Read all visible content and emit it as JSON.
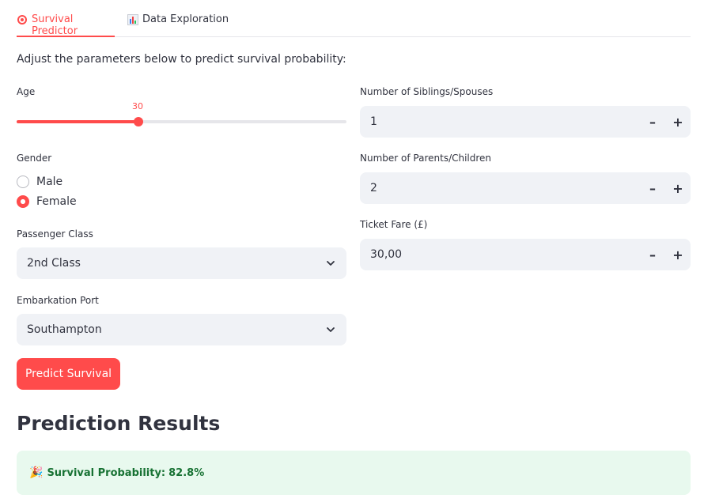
{
  "tabs": [
    {
      "label": "Survival Predictor",
      "icon": "target-icon",
      "active": true
    },
    {
      "label": "Data Exploration",
      "icon": "bar-chart-icon",
      "active": false
    }
  ],
  "instructions": "Adjust the parameters below to predict survival probability:",
  "age": {
    "label": "Age",
    "value": "30",
    "fraction": 0.36
  },
  "gender": {
    "label": "Gender",
    "options": [
      "Male",
      "Female"
    ],
    "selected": "Female"
  },
  "passenger_class": {
    "label": "Passenger Class",
    "value": "2nd Class"
  },
  "embarkation": {
    "label": "Embarkation Port",
    "value": "Southampton"
  },
  "siblings": {
    "label": "Number of Siblings/Spouses",
    "value": "1"
  },
  "parents": {
    "label": "Number of Parents/Children",
    "value": "2"
  },
  "fare": {
    "label": "Ticket Fare (£)",
    "value": "30,00"
  },
  "stepper": {
    "minus": "–",
    "plus": "+"
  },
  "predict_button": "Predict Survival",
  "results": {
    "heading": "Prediction Results",
    "emoji": "🎉",
    "label": "Survival Probability:",
    "value": "82.8%"
  },
  "colors": {
    "accent": "#ff4b4b",
    "success_bg": "#e8f9ee",
    "success_text": "#177233",
    "input_bg": "#f0f2f6"
  }
}
